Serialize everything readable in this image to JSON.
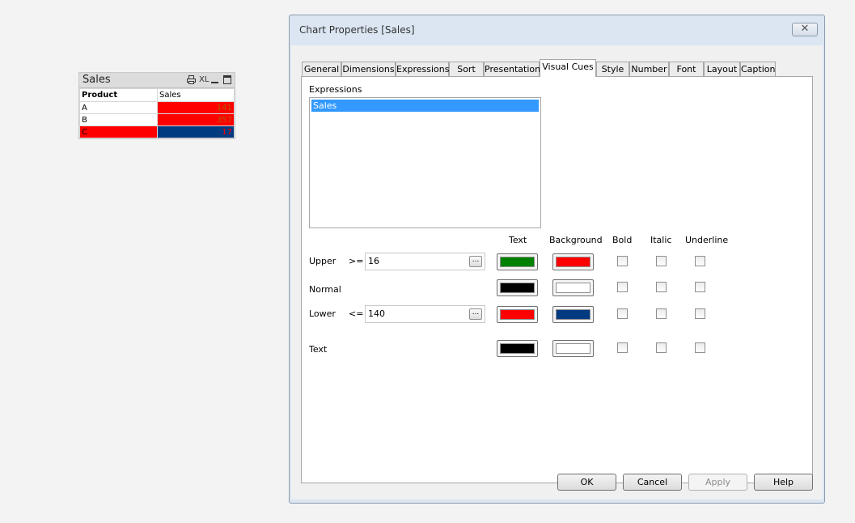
{
  "sales_box": {
    "title": "Sales",
    "icons": {
      "print": "print-icon",
      "xl": "XL",
      "minimize": "minimize-icon",
      "maximize": "maximize-icon"
    },
    "headers": [
      "Product",
      "Sales"
    ],
    "rows": [
      {
        "product": "A",
        "sales": "141",
        "product_bg": "#ffffff",
        "sales_bg": "#ff0000",
        "sales_color": "#b05a00"
      },
      {
        "product": "B",
        "sales": "357",
        "product_bg": "#ffffff",
        "sales_bg": "#ff0000",
        "sales_color": "#b05a00"
      },
      {
        "product": "C",
        "sales": "17",
        "product_bg": "#ff0000",
        "sales_bg": "#003a80",
        "sales_color": "#ff0000"
      }
    ]
  },
  "dialog": {
    "title": "Chart Properties [Sales]",
    "close_symbol": "✕",
    "tabs": [
      "General",
      "Dimensions",
      "Expressions",
      "Sort",
      "Presentation",
      "Visual Cues",
      "Style",
      "Number",
      "Font",
      "Layout",
      "Caption"
    ],
    "active_tab": "Visual Cues",
    "expressions_label": "Expressions",
    "expressions": [
      "Sales"
    ],
    "columns": {
      "text": "Text",
      "background": "Background",
      "bold": "Bold",
      "italic": "Italic",
      "underline": "Underline"
    },
    "rows": {
      "upper": {
        "label": "Upper",
        "operator": ">=",
        "value": "16",
        "text_color": "#008000",
        "bg_color": "#ff0000"
      },
      "normal": {
        "label": "Normal",
        "text_color": "#000000",
        "bg_color": "#ffffff"
      },
      "lower": {
        "label": "Lower",
        "operator": "<=",
        "value": "140",
        "text_color": "#ff0000",
        "bg_color": "#003a80"
      },
      "text": {
        "label": "Text",
        "text_color": "#000000",
        "bg_color": "#ffffff"
      }
    },
    "ellipsis": "...",
    "buttons": {
      "ok": "OK",
      "cancel": "Cancel",
      "apply": "Apply",
      "help": "Help"
    }
  }
}
